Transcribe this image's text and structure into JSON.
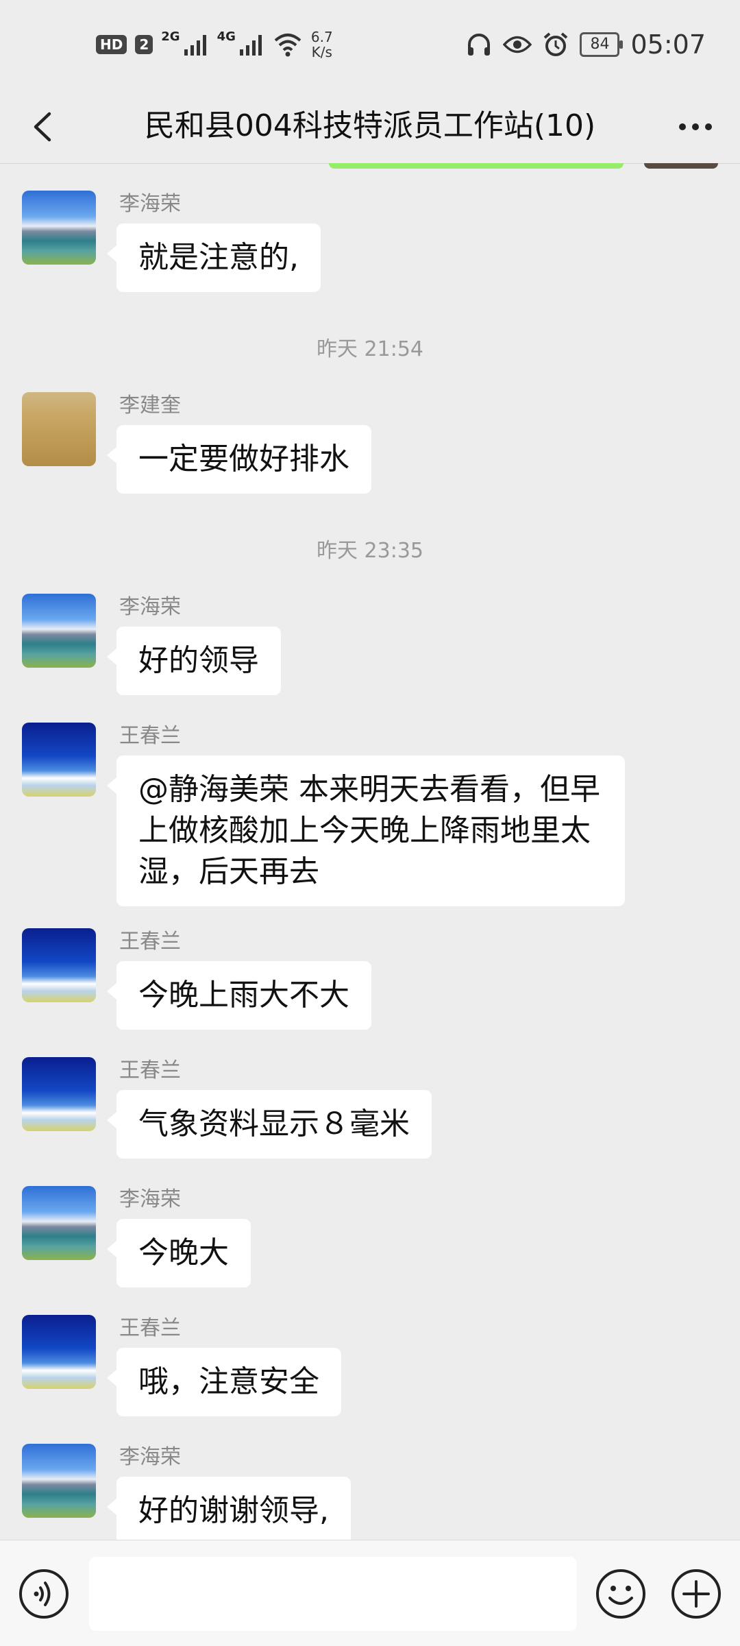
{
  "status_bar": {
    "hd_badge": "HD",
    "sim_slot": "2",
    "network_1": "2G",
    "network_2": "4G",
    "net_speed_value": "6.7",
    "net_speed_unit": "K/s",
    "battery": "84",
    "time": "05:07"
  },
  "header": {
    "title": "民和县004科技特派员工作站(10)"
  },
  "messages": [
    {
      "sender": "李海荣",
      "text": "就是注意的,"
    },
    {
      "sender": "李建奎",
      "text": "一定要做好排水"
    },
    {
      "sender": "李海荣",
      "text": "好的领导"
    },
    {
      "sender": "王春兰",
      "text": "@静海美荣  本来明天去看看，但早上做核酸加上今天晚上降雨地里太湿，后天再去"
    },
    {
      "sender": "王春兰",
      "text": "今晚上雨大不大"
    },
    {
      "sender": "王春兰",
      "text": "气象资料显示８毫米"
    },
    {
      "sender": "李海荣",
      "text": "今晚大"
    },
    {
      "sender": "王春兰",
      "text": "哦，注意安全"
    },
    {
      "sender": "李海荣",
      "text": "好的谢谢领导,"
    }
  ],
  "timestamps": [
    "昨天 21:54",
    "昨天 23:35"
  ],
  "input": {
    "value": ""
  }
}
